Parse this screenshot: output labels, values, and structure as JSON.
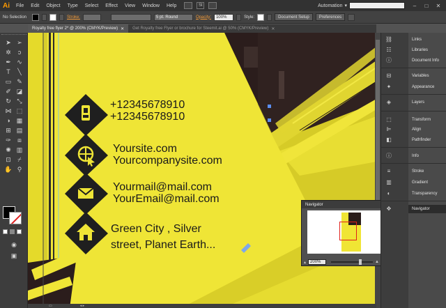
{
  "app": {
    "logo": "Ai",
    "menu": [
      "File",
      "Edit",
      "Object",
      "Type",
      "Select",
      "Effect",
      "View",
      "Window",
      "Help"
    ],
    "workspace": "Automation",
    "st_button": "St"
  },
  "control_bar": {
    "selection_label": "No Selection",
    "stroke_label": "Stroke:",
    "brush_value": "5 pt. Round",
    "opacity_label": "Opacity:",
    "opacity_value": "100%",
    "style_label": "Style:",
    "document_setup": "Document Setup",
    "preferences": "Preferences"
  },
  "tabs": [
    {
      "label": "Royalty free flyer 2* @ 200% (CMYK/Preview)",
      "active": true
    },
    {
      "label": "Get Royalty free Flyer or brochure for Steemit.ai @ 50% (CMYK/Preview)",
      "active": false
    }
  ],
  "contact": {
    "phone1": "+12345678910",
    "phone2": "+12345678910",
    "site1": "Yoursite.com",
    "site2": "Yourcompanysite.com",
    "mail1": "Yourmail@mail.com",
    "mail2": "YourEmail@mail.com",
    "addr1": "Green City , Silver",
    "addr2": "street, Planet Earth..."
  },
  "panels": [
    {
      "label": "Links",
      "icon": "links-icon"
    },
    {
      "label": "Libraries",
      "icon": "libraries-icon"
    },
    {
      "label": "Document Info",
      "icon": "document-info-icon"
    },
    {
      "label": "Variables",
      "icon": "variables-icon"
    },
    {
      "label": "Appearance",
      "icon": "appearance-icon"
    },
    {
      "label": "Layers",
      "icon": "layers-icon"
    },
    {
      "label": "Transform",
      "icon": "transform-icon"
    },
    {
      "label": "Align",
      "icon": "align-icon"
    },
    {
      "label": "Pathfinder",
      "icon": "pathfinder-icon"
    },
    {
      "label": "Info",
      "icon": "info-icon"
    },
    {
      "label": "Stroke",
      "icon": "stroke-icon"
    },
    {
      "label": "Gradient",
      "icon": "gradient-icon"
    },
    {
      "label": "Transparency",
      "icon": "transparency-icon"
    },
    {
      "label": "Navigator",
      "icon": "navigator-icon"
    }
  ],
  "navigator": {
    "title": "Navigator",
    "zoom": "200%"
  },
  "colors": {
    "flyer_yellow": "#efe536",
    "dark_photo": "#2b1d1c",
    "icon_diamond": "#1f1f1f",
    "accent_orange": "#f39c3b"
  }
}
